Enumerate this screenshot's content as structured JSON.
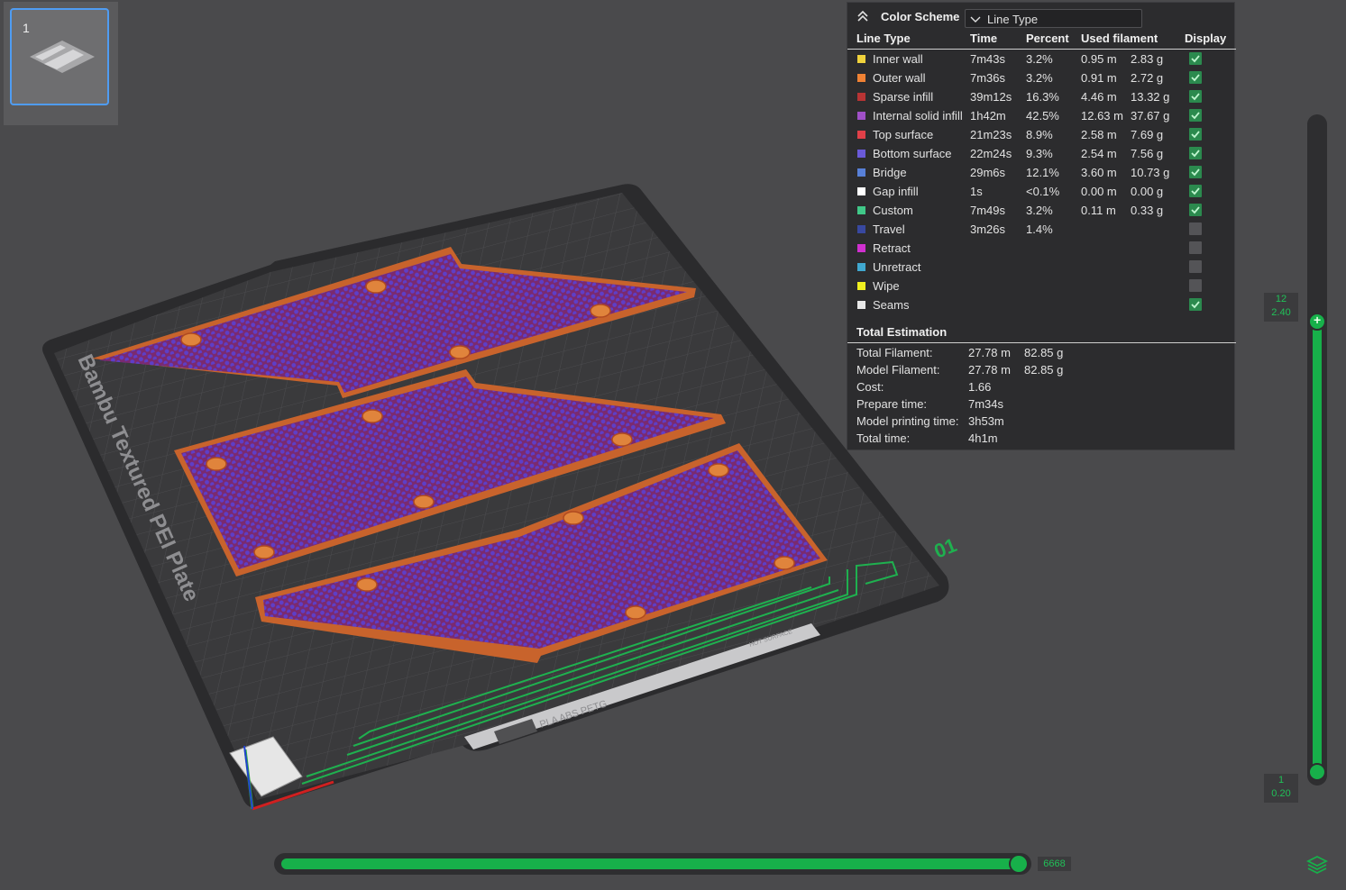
{
  "plate_thumbnail": {
    "number": "1"
  },
  "legend": {
    "title": "Color Scheme",
    "scheme_value": "Line Type",
    "columns": {
      "type": "Line Type",
      "time": "Time",
      "percent": "Percent",
      "used": "Used filament",
      "display": "Display"
    },
    "rows": [
      {
        "name": "Inner wall",
        "color": "#f0d23c",
        "time": "7m43s",
        "percent": "3.2%",
        "length": "0.95 m",
        "weight": "2.83 g",
        "display": true
      },
      {
        "name": "Outer wall",
        "color": "#f08234",
        "time": "7m36s",
        "percent": "3.2%",
        "length": "0.91 m",
        "weight": "2.72 g",
        "display": true
      },
      {
        "name": "Sparse infill",
        "color": "#b83434",
        "time": "39m12s",
        "percent": "16.3%",
        "length": "4.46 m",
        "weight": "13.32 g",
        "display": true
      },
      {
        "name": "Internal solid infill",
        "color": "#a050c8",
        "time": "1h42m",
        "percent": "42.5%",
        "length": "12.63 m",
        "weight": "37.67 g",
        "display": true
      },
      {
        "name": "Top surface",
        "color": "#e04048",
        "time": "21m23s",
        "percent": "8.9%",
        "length": "2.58 m",
        "weight": "7.69 g",
        "display": true
      },
      {
        "name": "Bottom surface",
        "color": "#6a5ad8",
        "time": "22m24s",
        "percent": "9.3%",
        "length": "2.54 m",
        "weight": "7.56 g",
        "display": true
      },
      {
        "name": "Bridge",
        "color": "#5880d8",
        "time": "29m6s",
        "percent": "12.1%",
        "length": "3.60 m",
        "weight": "10.73 g",
        "display": true
      },
      {
        "name": "Gap infill",
        "color": "#ffffff",
        "time": "1s",
        "percent": "<0.1%",
        "length": "0.00 m",
        "weight": "0.00 g",
        "display": true
      },
      {
        "name": "Custom",
        "color": "#40c888",
        "time": "7m49s",
        "percent": "3.2%",
        "length": "0.11 m",
        "weight": "0.33 g",
        "display": true
      },
      {
        "name": "Travel",
        "color": "#3848a0",
        "time": "3m26s",
        "percent": "1.4%",
        "length": "",
        "weight": "",
        "display": false
      },
      {
        "name": "Retract",
        "color": "#d030d0",
        "time": "",
        "percent": "",
        "length": "",
        "weight": "",
        "display": false
      },
      {
        "name": "Unretract",
        "color": "#40a8d0",
        "time": "",
        "percent": "",
        "length": "",
        "weight": "",
        "display": false
      },
      {
        "name": "Wipe",
        "color": "#f0f020",
        "time": "",
        "percent": "",
        "length": "",
        "weight": "",
        "display": false
      },
      {
        "name": "Seams",
        "color": "#e8e8e8",
        "time": "",
        "percent": "",
        "length": "",
        "weight": "",
        "display": true
      }
    ],
    "total_title": "Total Estimation",
    "totals": [
      {
        "label": "Total Filament:",
        "v1": "27.78 m",
        "v2": "82.85 g"
      },
      {
        "label": "Model Filament:",
        "v1": "27.78 m",
        "v2": "82.85 g"
      },
      {
        "label": "Cost:",
        "v1": "1.66",
        "v2": ""
      },
      {
        "label": "Prepare time:",
        "v1": "7m34s",
        "v2": ""
      },
      {
        "label": "Model printing time:",
        "v1": "3h53m",
        "v2": ""
      },
      {
        "label": "Total time:",
        "v1": "4h1m",
        "v2": ""
      }
    ]
  },
  "plate": {
    "name": "Bambu Textured PEI Plate",
    "number": "01",
    "filament_label": "PLA ABS PETG",
    "secondary_label": "HOT SURFACE"
  },
  "layer_slider": {
    "top_layer": "12",
    "top_height": "2.40",
    "bottom_layer": "1",
    "bottom_height": "0.20"
  },
  "move_slider": {
    "value": "6668"
  },
  "colors": {
    "accent": "#17b04a",
    "panel": "#2c2c2e",
    "background": "#4a4a4c"
  }
}
